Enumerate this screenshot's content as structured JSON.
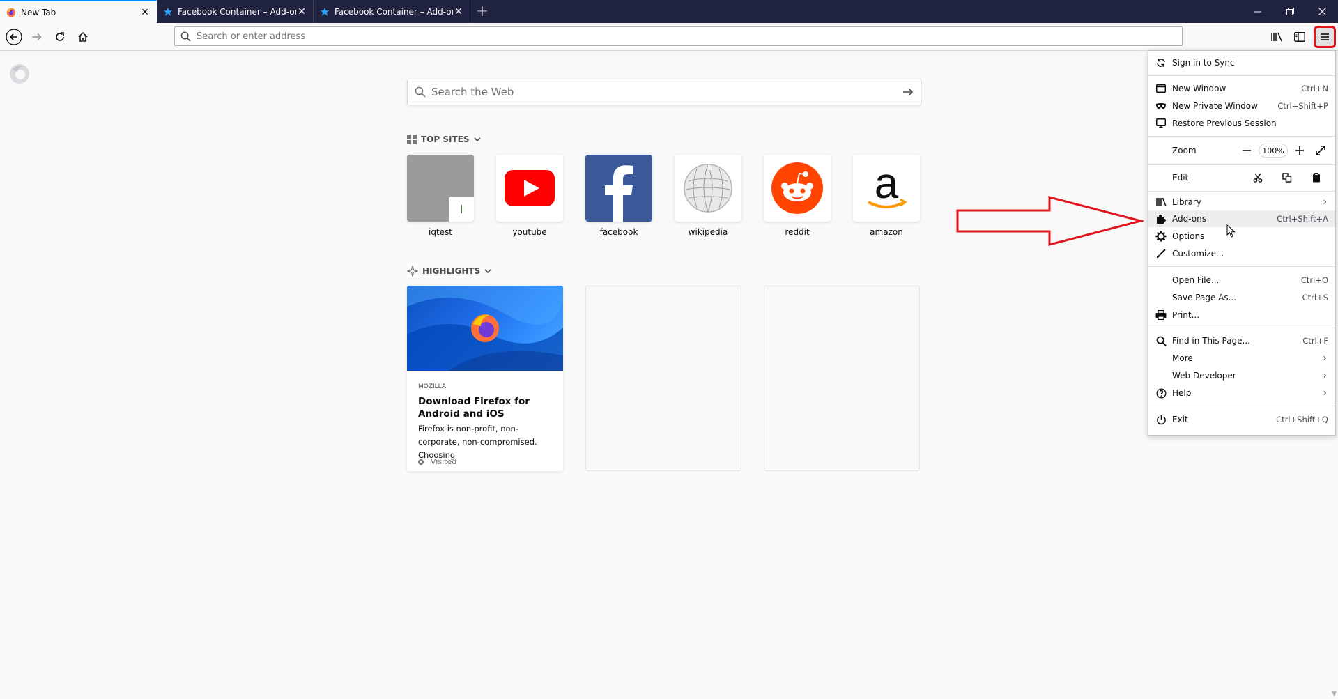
{
  "tabs": [
    {
      "label": "New Tab",
      "active": true,
      "icon": "firefox-icon"
    },
    {
      "label": "Facebook Container – Add-ons",
      "active": false,
      "icon": "facebook-container-icon"
    },
    {
      "label": "Facebook Container – Add-ons",
      "active": false,
      "icon": "facebook-container-icon"
    }
  ],
  "urlbar": {
    "placeholder": "Search or enter address"
  },
  "websearch": {
    "placeholder": "Search the Web"
  },
  "top_sites": {
    "title": "Top Sites",
    "sites": [
      {
        "label": "iqtest"
      },
      {
        "label": "youtube"
      },
      {
        "label": "facebook"
      },
      {
        "label": "wikipedia"
      },
      {
        "label": "reddit"
      },
      {
        "label": "amazon"
      }
    ]
  },
  "highlights": {
    "title": "Highlights",
    "card": {
      "source": "MOZILLA",
      "title": "Download Firefox for Android and iOS",
      "description": "Firefox is non-profit, non-corporate, non-compromised. Choosing",
      "status": "Visited"
    }
  },
  "app_menu": {
    "sign_in": "Sign in to Sync",
    "new_window": {
      "label": "New Window",
      "shortcut": "Ctrl+N"
    },
    "new_private_window": {
      "label": "New Private Window",
      "shortcut": "Ctrl+Shift+P"
    },
    "restore_session": {
      "label": "Restore Previous Session"
    },
    "zoom": {
      "label": "Zoom",
      "value": "100%"
    },
    "edit": {
      "label": "Edit"
    },
    "library": {
      "label": "Library"
    },
    "addons": {
      "label": "Add-ons",
      "shortcut": "Ctrl+Shift+A"
    },
    "options": {
      "label": "Options"
    },
    "customize": {
      "label": "Customize..."
    },
    "open_file": {
      "label": "Open File...",
      "shortcut": "Ctrl+O"
    },
    "save_page": {
      "label": "Save Page As...",
      "shortcut": "Ctrl+S"
    },
    "print": {
      "label": "Print..."
    },
    "find": {
      "label": "Find in This Page...",
      "shortcut": "Ctrl+F"
    },
    "more": {
      "label": "More"
    },
    "web_developer": {
      "label": "Web Developer"
    },
    "help": {
      "label": "Help"
    },
    "exit": {
      "label": "Exit",
      "shortcut": "Ctrl+Shift+Q"
    }
  },
  "colors": {
    "tabstrip_bg": "#202340",
    "accent": "#0a84ff",
    "annotation_red": "#e0161e"
  }
}
